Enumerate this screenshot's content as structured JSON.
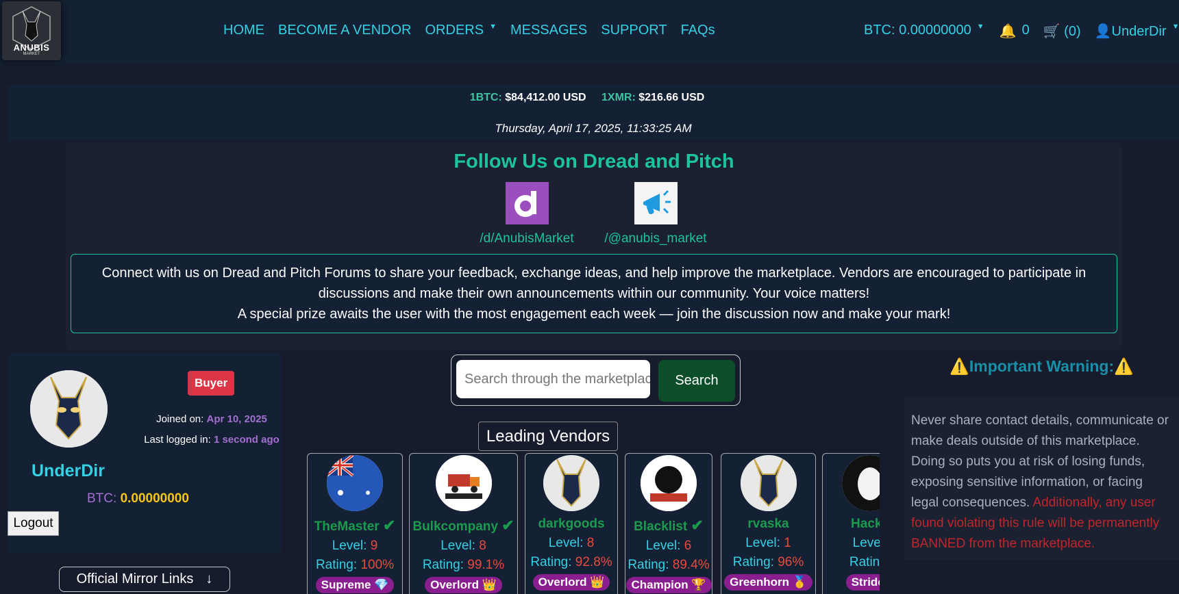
{
  "logo": {
    "name": "ANUBIS",
    "sub": "MARKET"
  },
  "nav": {
    "home": "HOME",
    "become_vendor": "BECOME A VENDOR",
    "orders": "ORDERS",
    "messages": "MESSAGES",
    "support": "SUPPORT",
    "faqs": "FAQs"
  },
  "header_right": {
    "btc": "BTC: 0.00000000",
    "notifications": "0",
    "cart": "(0)",
    "user": "UnderDir"
  },
  "ticker": {
    "btc_label": "1BTC:",
    "btc_value": "$84,412.00 USD",
    "xmr_label": "1XMR:",
    "xmr_value": "$216.66 USD",
    "datetime": "Thursday, April 17, 2025, 11:33:25 AM"
  },
  "follow": {
    "title": "Follow Us on Dread and Pitch",
    "dread_link": "/d/AnubisMarket",
    "pitch_link": "/@anubis_market",
    "notice_line1": "Connect with us on Dread and Pitch Forums to share your feedback, exchange ideas, and help improve the marketplace. Vendors are encouraged to participate in",
    "notice_line2": "discussions and make their own announcements within our community. Your voice matters!",
    "notice_line3": "A special prize awaits the user with the most engagement each week — join the discussion now and make your mark!"
  },
  "profile": {
    "role": "Buyer",
    "joined_label": "Joined on:",
    "joined_value": "Apr 10, 2025",
    "last_login_label": "Last logged in:",
    "last_login_value": "1 second ago",
    "username": "UnderDir",
    "btc_label": "BTC:",
    "btc_value": "0.00000000",
    "logout": "Logout",
    "mirror_links": "Official Mirror Links",
    "mirror_arrow": "↓"
  },
  "search": {
    "placeholder": "Search through the marketplace",
    "button": "Search"
  },
  "leading_vendors": {
    "title": "Leading Vendors",
    "level_label": "Level:",
    "rating_label": "Rating:",
    "vendors": [
      {
        "name": "TheMaster",
        "verified": "✔",
        "level": "9",
        "rating": "100%",
        "badge": "Supreme 💎"
      },
      {
        "name": "Bulkcompany",
        "verified": "✔",
        "level": "8",
        "rating": "99.1%",
        "badge": "Overlord 👑"
      },
      {
        "name": "darkgoods",
        "verified": "",
        "level": "8",
        "rating": "92.8%",
        "badge": "Overlord 👑"
      },
      {
        "name": "Blacklist",
        "verified": "✔",
        "level": "6",
        "rating": "89.4%",
        "badge": "Champion 🏆"
      },
      {
        "name": "rvaska",
        "verified": "",
        "level": "1",
        "rating": "96%",
        "badge": "Greenhorn 🥇"
      },
      {
        "name": "Hacky",
        "verified": "",
        "level": "",
        "rating": "",
        "badge": "Strider"
      }
    ]
  },
  "warning": {
    "title": "⚠️Important Warning:⚠️",
    "body": "Never share contact details, communicate or make deals outside of this marketplace. Doing so puts you at risk of losing funds, exposing sensitive information, or facing legal consequences.",
    "body_red": "Additionally, any user found violating this rule will be permanently BANNED from the marketplace."
  },
  "colors": {
    "accent": "#35d0e3",
    "green": "#1cc39c",
    "buyer_badge": "#dc3545",
    "purple": "#a36fd1"
  }
}
